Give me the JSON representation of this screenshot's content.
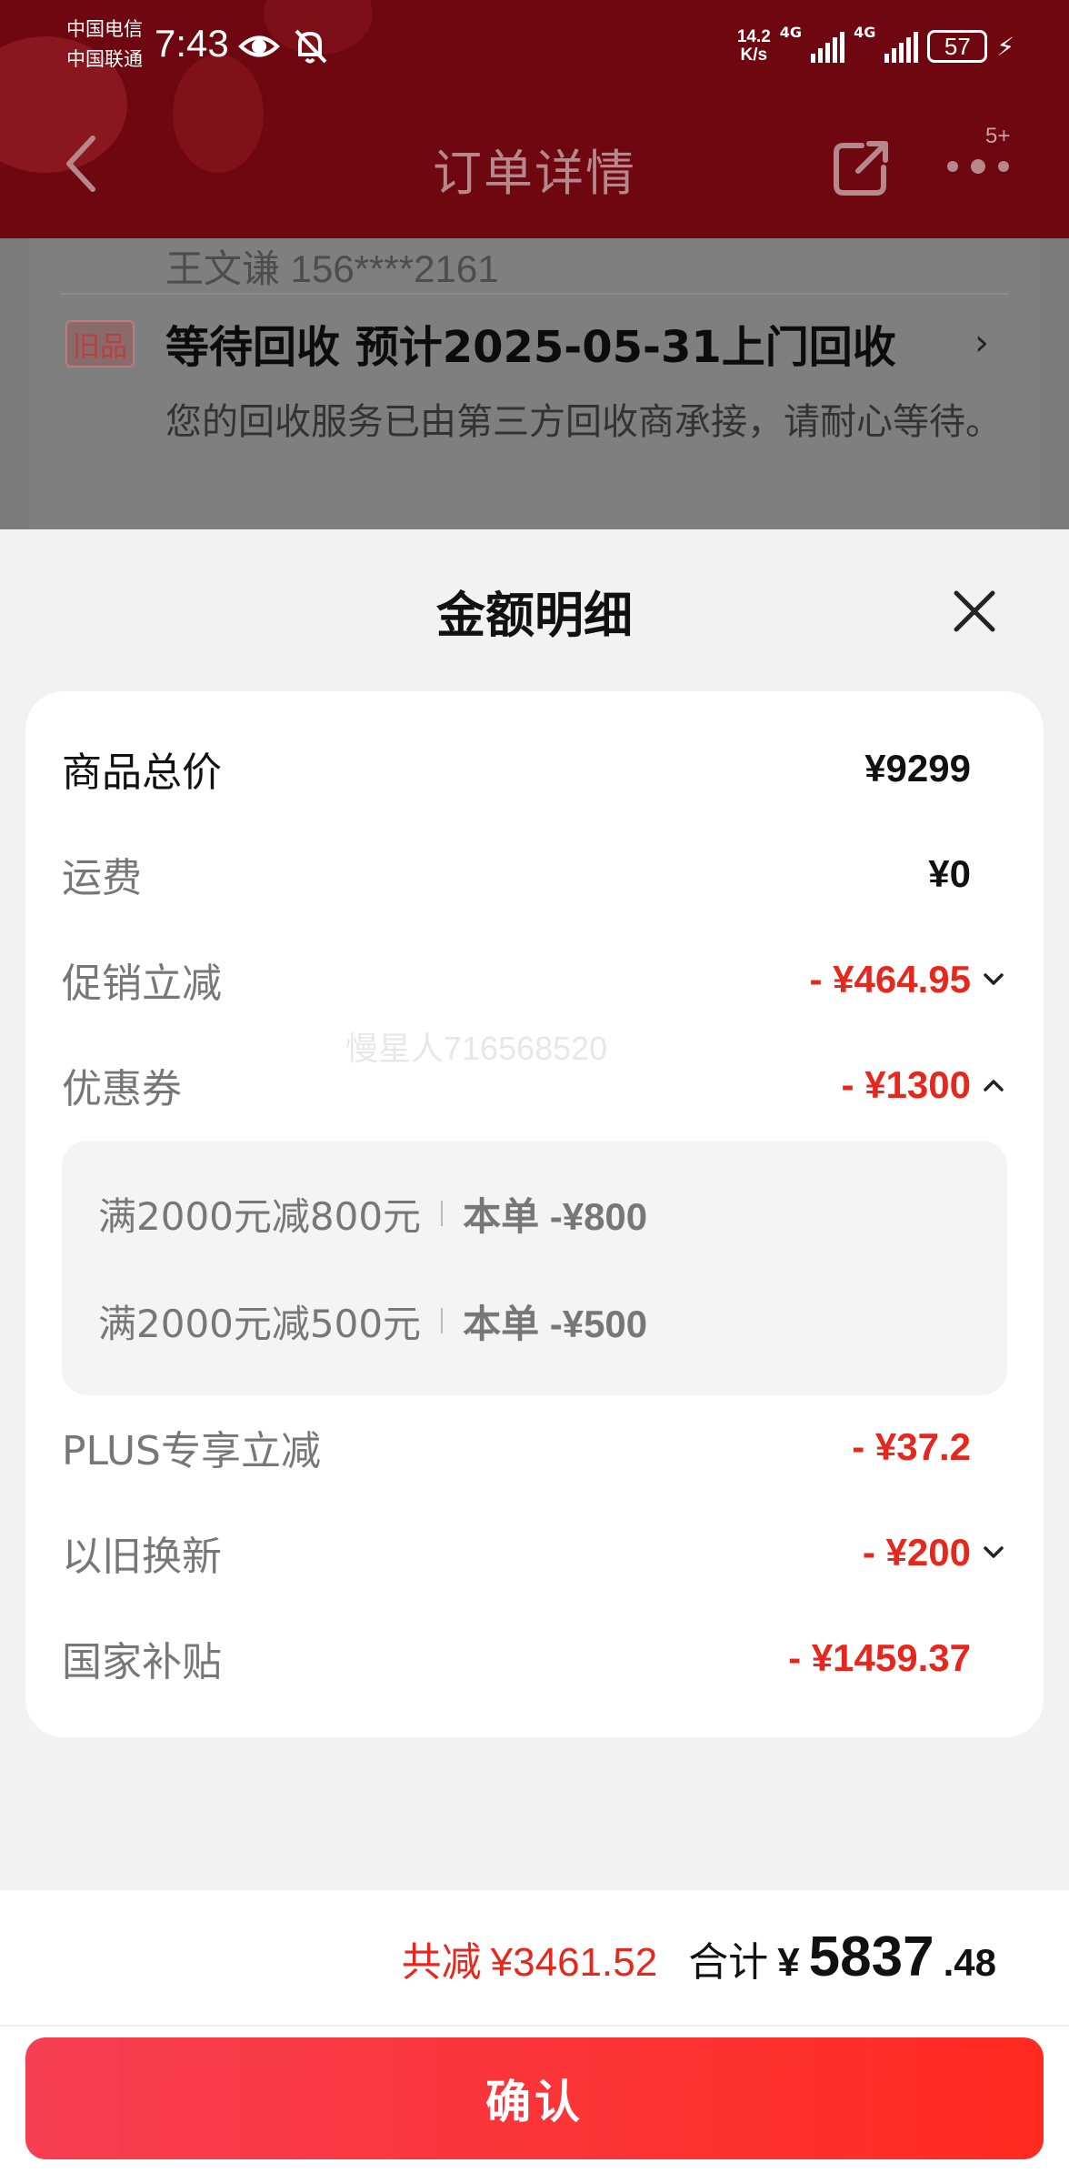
{
  "status_bar": {
    "carrier_1": "中国电信",
    "carrier_2": "中国联通",
    "time": "7:43",
    "net_speed_value": "14.2",
    "net_speed_unit": "K/s",
    "signal_1_label": "4G",
    "signal_2_label": "4G",
    "battery": "57"
  },
  "header": {
    "title": "订单详情",
    "more_badge": "5+"
  },
  "background_order": {
    "contact": "王文谦 156****2161",
    "tag": "旧品",
    "status": "等待回收 预计2025-05-31上门回收",
    "description": "您的回收服务已由第三方回收商承接，请耐心等待。"
  },
  "sheet": {
    "title": "金额明细",
    "rows": [
      {
        "label": "商品总价",
        "value": "¥9299"
      },
      {
        "label": "运费",
        "value": "¥0"
      },
      {
        "label": "促销立减",
        "value": "- ¥464.95"
      },
      {
        "label": "优惠券",
        "value": "- ¥1300"
      },
      {
        "label": "PLUS专享立减",
        "value": "- ¥37.2"
      },
      {
        "label": "以旧换新",
        "value": "- ¥200"
      },
      {
        "label": "国家补贴",
        "value": "- ¥1459.37"
      }
    ],
    "coupons": [
      {
        "desc": "满2000元减800元",
        "applied": "本单 -¥800"
      },
      {
        "desc": "满2000元减500元",
        "applied": "本单 -¥500"
      }
    ],
    "watermark": "慢星人716568520"
  },
  "footer": {
    "saved_label": "共减",
    "saved_amount": "¥3461.52",
    "total_label": "合计",
    "total_yen": "¥",
    "total_int": "5837",
    "total_dec": ".48",
    "confirm_label": "确认"
  },
  "colors": {
    "header_bg": "#6e0710",
    "accent_red": "#e6271e",
    "button_gradient_start": "#f63f52",
    "button_gradient_end": "#ff2a1f"
  }
}
